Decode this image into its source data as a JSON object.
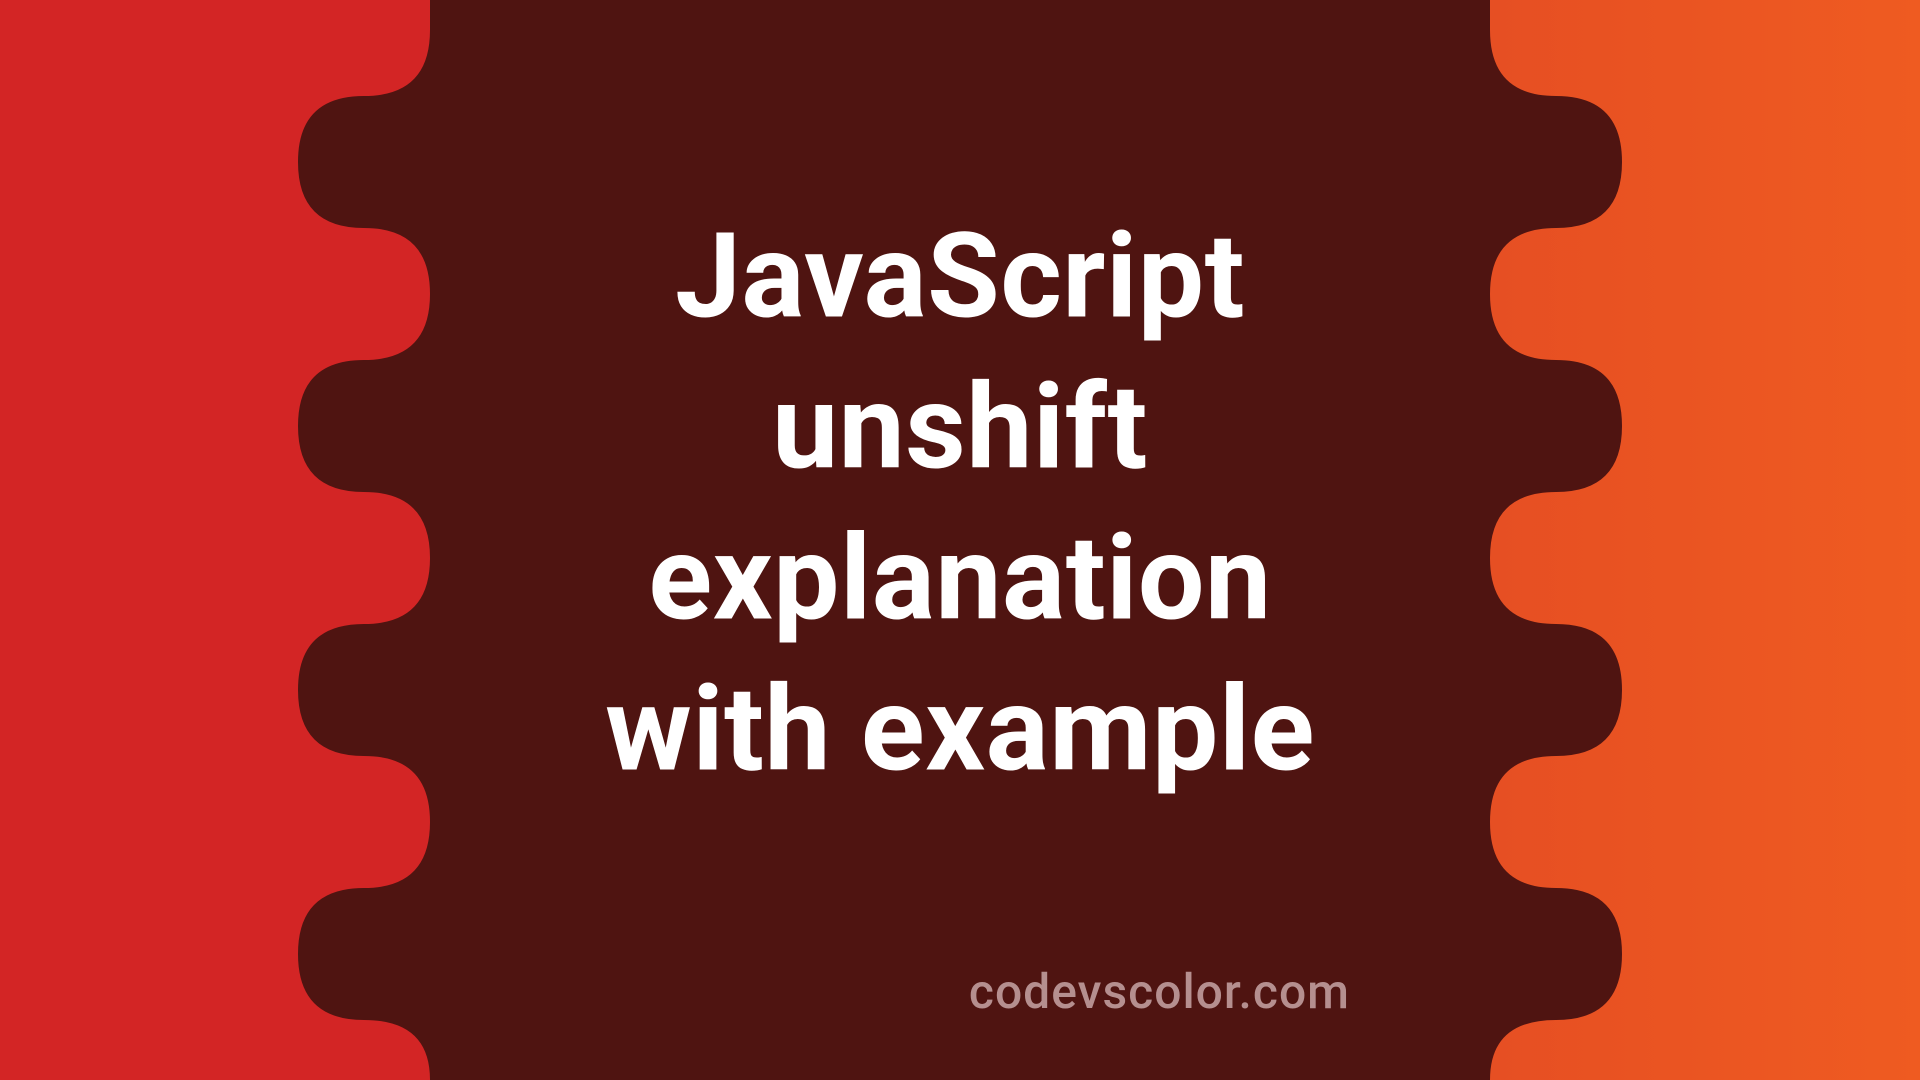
{
  "colors": {
    "gradient_left": "#d32525",
    "gradient_right": "#ef5b21",
    "blob": "#4f1411",
    "text": "#ffffff",
    "watermark": "#b58f8f"
  },
  "title_lines": "JavaScript\nunshift\nexplanation\nwith example",
  "watermark": "codevscolor.com"
}
